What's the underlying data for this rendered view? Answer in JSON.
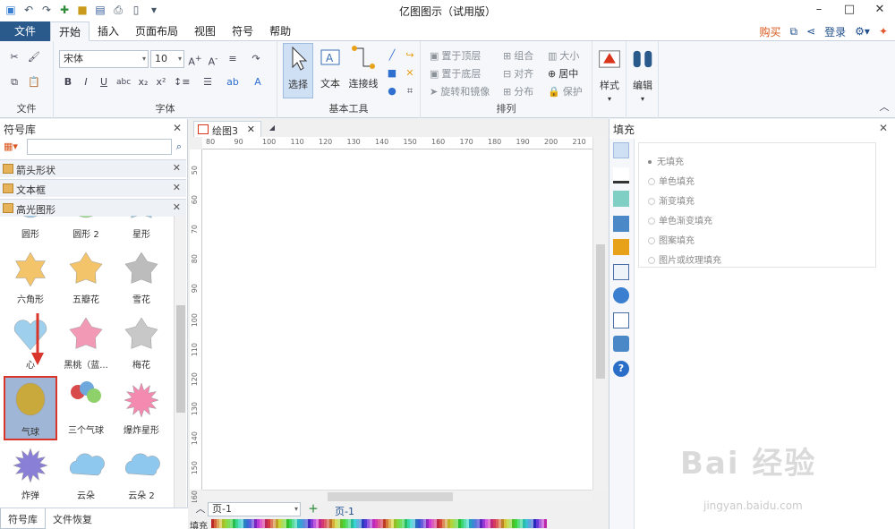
{
  "window": {
    "title": "亿图图示（试用版）"
  },
  "ribbon_tabs": [
    "文件",
    "开始",
    "插入",
    "页面布局",
    "视图",
    "符号",
    "帮助"
  ],
  "tab_right": {
    "buy": "购买",
    "login": "登录"
  },
  "ribbon": {
    "file_group_label": "文件",
    "font_group_label": "字体",
    "font_name": "宋体",
    "font_size": "10",
    "tools_group_label": "基本工具",
    "select_label": "选择",
    "text_label": "文本",
    "connector_label": "连接线",
    "arrange_group_label": "排列",
    "arrange_items": [
      "置于顶层",
      "组合",
      "大小",
      "置于底层",
      "对齐",
      "居中",
      "旋转和镜像",
      "分布",
      "保护"
    ],
    "style_label": "样式",
    "edit_label": "编辑"
  },
  "symbol_panel": {
    "title": "符号库",
    "categories": [
      "箭头形状",
      "文本框",
      "高光图形"
    ],
    "shapes": [
      {
        "label": "圆形",
        "color": "#9ed0ee"
      },
      {
        "label": "圆形 2",
        "color": "#a6e09a"
      },
      {
        "label": "星形",
        "color": "#9ed0ee"
      },
      {
        "label": "六角形",
        "color": "#f3c46a"
      },
      {
        "label": "五瓣花",
        "color": "#f3c46a"
      },
      {
        "label": "雪花",
        "color": "#bcbcbc"
      },
      {
        "label": "心",
        "color": "#9ed0ee"
      },
      {
        "label": "黑桃（蓝...",
        "color": "#f29ab5"
      },
      {
        "label": "梅花",
        "color": "#c8c8c8"
      },
      {
        "label": "气球",
        "color": "#c9a83c"
      },
      {
        "label": "三个气球",
        "color": "#6fa8dc"
      },
      {
        "label": "爆炸星形",
        "color": "#f48ab0"
      },
      {
        "label": "炸弹",
        "color": "#8a7fd6"
      },
      {
        "label": "云朵",
        "color": "#8fc8ee"
      },
      {
        "label": "云朵 2",
        "color": "#8fc8ee"
      }
    ],
    "bottom_tabs": [
      "符号库",
      "文件恢复"
    ]
  },
  "document": {
    "tab_name": "绘图3",
    "ruler_top": [
      "80",
      "90",
      "100",
      "110",
      "120",
      "130",
      "140",
      "150",
      "160",
      "170",
      "180",
      "190",
      "200",
      "210"
    ],
    "ruler_left": [
      "50",
      "60",
      "70",
      "80",
      "90",
      "100",
      "110",
      "120",
      "130",
      "140",
      "150",
      "160"
    ],
    "page_select": "页-1",
    "page_tab": "页-1",
    "fill_label": "填充"
  },
  "fill_panel": {
    "title": "填充",
    "options": [
      "无填充",
      "单色填充",
      "渐变填充",
      "单色渐变填充",
      "图案填充",
      "图片或纹理填充"
    ]
  },
  "watermark": {
    "main": "Bai 经验",
    "sub": "jingyan.baidu.com"
  },
  "colors": {
    "accent": "#2a5a8c",
    "selection_red": "#d9352b"
  }
}
